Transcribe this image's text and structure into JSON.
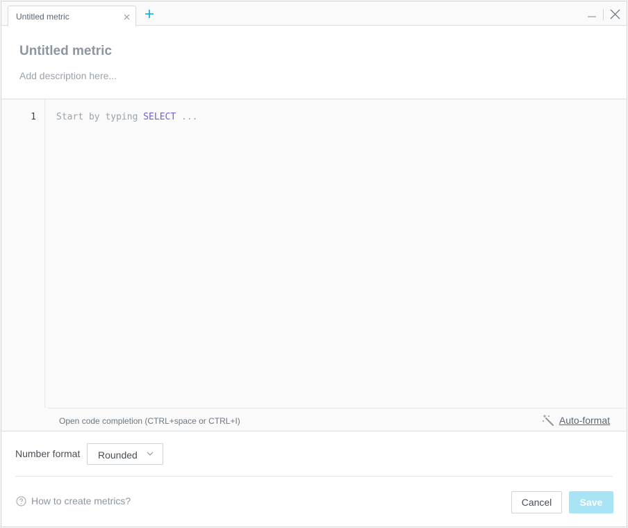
{
  "tabs": [
    {
      "label": "Untitled metric",
      "active": true
    }
  ],
  "header": {
    "title": "Untitled metric",
    "description_placeholder": "Add description here..."
  },
  "editor": {
    "line_numbers": [
      "1"
    ],
    "placeholder_prefix": "Start by typing ",
    "placeholder_keyword": "SELECT",
    "placeholder_suffix": " ...",
    "hint": "Open code completion (CTRL+space or CTRL+I)",
    "autoformat_label": "Auto-format"
  },
  "number_format": {
    "label": "Number format",
    "selected": "Rounded"
  },
  "footer": {
    "help_label": "How to create metrics?",
    "cancel_label": "Cancel",
    "save_label": "Save"
  },
  "colors": {
    "accent": "#00a9e0",
    "save_disabled": "#a9e3f6",
    "keyword": "#6f64c9"
  },
  "icons": [
    "close-icon",
    "plus-icon",
    "minimize-icon",
    "window-close-icon",
    "magic-wand-icon",
    "chevron-down-icon",
    "question-circle-icon"
  ]
}
